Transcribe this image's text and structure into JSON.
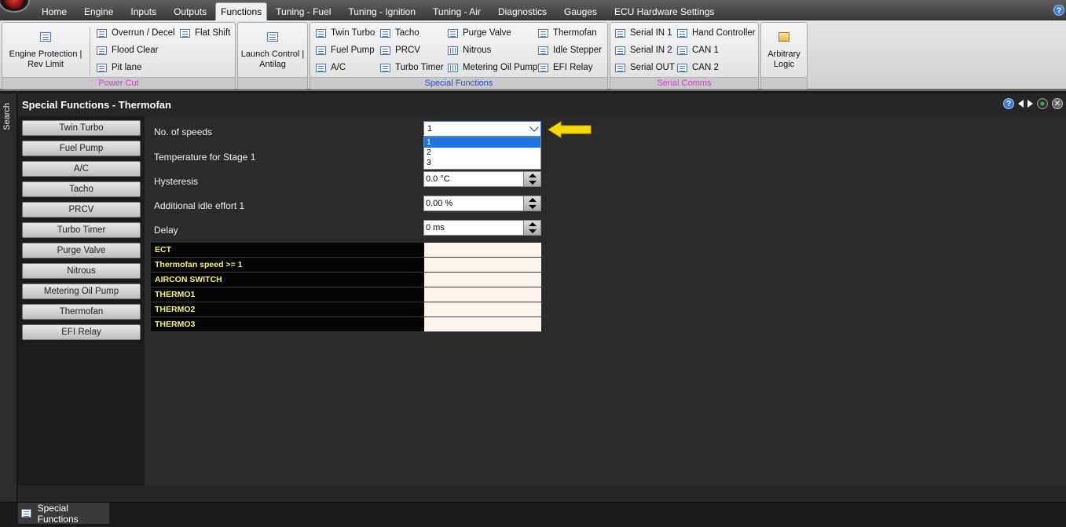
{
  "menu": {
    "tabs": [
      "Home",
      "Engine",
      "Inputs",
      "Outputs",
      "Functions",
      "Tuning - Fuel",
      "Tuning - Ignition",
      "Tuning - Air",
      "Diagnostics",
      "Gauges",
      "ECU Hardware Settings"
    ],
    "active_tab": "Functions",
    "help_label": "?"
  },
  "ribbon": {
    "power_cut": {
      "label": "Power Cut",
      "big_button": "Engine Protection | Rev Limit",
      "items": [
        "Overrun / Decel",
        "Flat Shift",
        "Flood Clear",
        "Pit lane"
      ]
    },
    "launch": {
      "big_button": "Launch Control | Antilag"
    },
    "special_functions": {
      "label": "Special Functions",
      "items": [
        "Twin Turbo",
        "Tacho",
        "Purge Valve",
        "Thermofan",
        "Fuel Pump",
        "PRCV",
        "Nitrous",
        "Idle Stepper",
        "A/C",
        "Turbo Timer",
        "Metering Oil Pump",
        "EFI Relay"
      ]
    },
    "serial_comms": {
      "label": "Serial Comms",
      "items": [
        "Serial IN 1",
        "Hand Controller",
        "Serial IN 2",
        "CAN 1",
        "Serial OUT",
        "CAN 2"
      ]
    },
    "arbitrary": {
      "big_button": "Arbitrary Logic"
    },
    "label_colors": {
      "magenta": "#d040d0",
      "blue": "#2b4bd8"
    }
  },
  "search_strip": {
    "label": "Search"
  },
  "panel": {
    "title": "Special Functions - Thermofan",
    "side_buttons": [
      "Twin Turbo",
      "Fuel Pump",
      "A/C",
      "Tacho",
      "PRCV",
      "Turbo Timer",
      "Purge Valve",
      "Nitrous",
      "Metering Oil Pump",
      "Thermofan",
      "EFI Relay"
    ],
    "fields": {
      "speeds_label": "No. of speeds",
      "speeds_value": "1",
      "speeds_options": [
        "1",
        "2",
        "3"
      ],
      "stage1_label": "Temperature for Stage 1",
      "hysteresis_label": "Hysteresis",
      "hysteresis_value": "0.0 °C",
      "idle_label": "Additional idle effort 1",
      "idle_value": "0.00 %",
      "delay_label": "Delay",
      "delay_value": "0 ms"
    },
    "grid_rows": [
      "ECT",
      "Thermofan speed >= 1",
      "AIRCON SWITCH",
      "THERMO1",
      "THERMO2",
      "THERMO3"
    ],
    "indicator_color": "#f5d90a"
  },
  "status": {
    "bottom_tab": "Special Functions"
  }
}
